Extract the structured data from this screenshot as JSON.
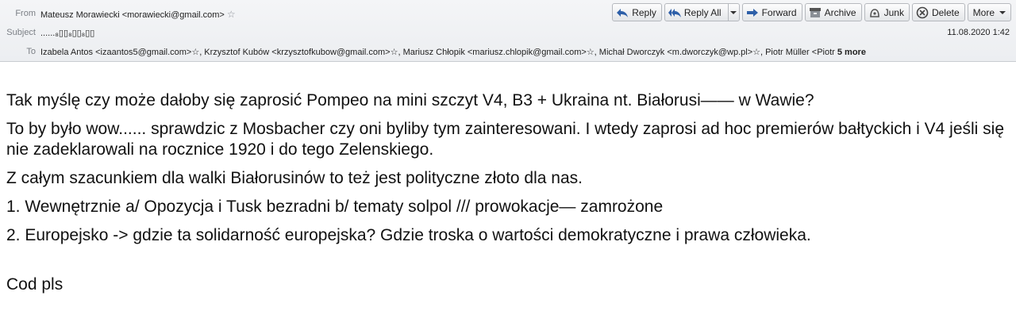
{
  "header": {
    "from_label": "From",
    "from_value": "Mateusz Morawiecki <morawiecki@gmail.com>",
    "subject_label": "Subject",
    "subject_value": "......₈▯▯₈▯▯₈▯▯",
    "date": "11.08.2020 1:42",
    "to_label": "To",
    "to_value": "Izabela Antos <izaantos5@gmail.com>☆, Krzysztof Kubów <krzysztofkubow@gmail.com>☆, Mariusz Chłopik <mariusz.chlopik@gmail.com>☆, Michał Dworczyk <m.dworczyk@wp.pl>☆, Piotr Müller <Piotr",
    "more_link": "5 more"
  },
  "toolbar": {
    "reply": "Reply",
    "reply_all": "Reply All",
    "forward": "Forward",
    "archive": "Archive",
    "junk": "Junk",
    "delete": "Delete",
    "more": "More"
  },
  "body": {
    "p1": "Tak myślę czy może dałoby się zaprosić Pompeo na mini szczyt V4, B3 + Ukraina nt. Białorusi—— w Wawie?",
    "p2": "To by było wow...... sprawdzic z Mosbacher czy oni byliby tym zainteresowani. I wtedy zaprosi ad hoc premierów bałtyckich i V4 jeśli się nie zadeklarowali na rocznice 1920 i do tego Zelenskiego.",
    "p3": "Z całym szacunkiem dla walki Białorusinów to też jest polityczne złoto dla nas.",
    "p4": "1. Wewnętrznie a/ Opozycja i Tusk bezradni b/ tematy solpol /// prowokacje— zamrożone",
    "p5": "2. Europejsko -> gdzie ta solidarność europejska? Gdzie troska o wartości demokratyczne i prawa człowieka.",
    "p6": "Cod pls"
  }
}
